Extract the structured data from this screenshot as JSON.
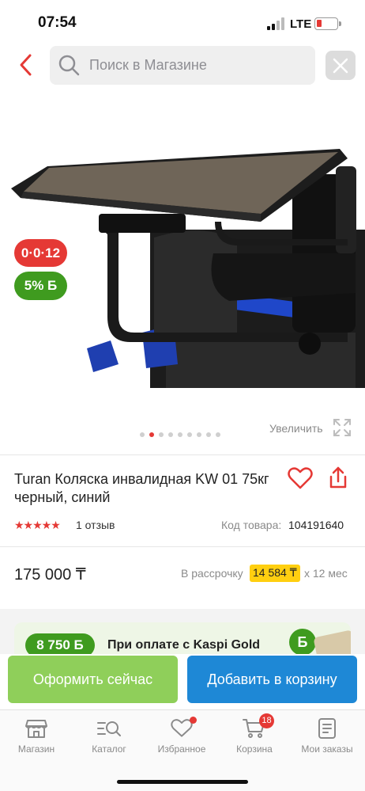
{
  "status_bar": {
    "time": "07:54",
    "network": "LTE"
  },
  "search": {
    "placeholder": "Поиск в Магазине"
  },
  "badges": {
    "installment": "0·0·12",
    "bonus": "5% Б"
  },
  "gallery": {
    "image_count": 9,
    "active_index": 1,
    "zoom_label": "Увеличить"
  },
  "product": {
    "title": "Turan Коляска инвалидная KW 01 75кг черный, синий",
    "rating_stars": "★★★★★",
    "rating": 5,
    "reviews": "1 отзыв",
    "code_label": "Код товара:",
    "code": "104191640",
    "price": "175 000 ₸",
    "installment_label": "В рассрочку",
    "installment_amount": "14 584 ₸",
    "installment_months": "x 12 мес"
  },
  "kaspi_promo": {
    "bonus": "8 750 Б",
    "text": "При оплате с Kaspi Gold",
    "coin": "Б"
  },
  "actions": {
    "buy_now": "Оформить сейчас",
    "add_to_cart": "Добавить в корзину"
  },
  "nav": {
    "items": [
      {
        "label": "Магазин",
        "icon": "shop-icon"
      },
      {
        "label": "Каталог",
        "icon": "catalog-icon"
      },
      {
        "label": "Избранное",
        "icon": "heart-icon"
      },
      {
        "label": "Корзина",
        "icon": "cart-icon",
        "badge": "18"
      },
      {
        "label": "Мои заказы",
        "icon": "orders-icon"
      }
    ]
  },
  "colors": {
    "accent_red": "#e53935",
    "kaspi_green": "#3f9b1f",
    "buy_green": "#8fcf5a",
    "cart_blue": "#1e88d6",
    "installment_yellow": "#ffcf10"
  }
}
